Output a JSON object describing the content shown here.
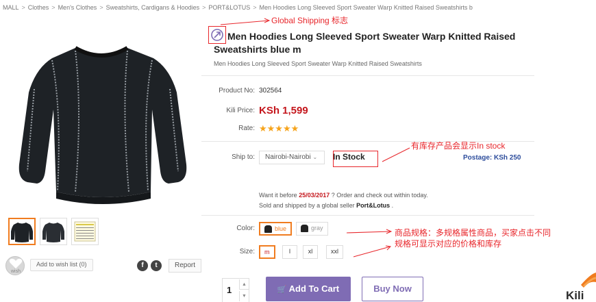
{
  "breadcrumb": [
    "MALL",
    "Clothes",
    "Men's Clothes",
    "Sweatshirts, Cardigans & Hoodies",
    "PORT&LOTUS",
    "Men Hoodies Long Sleeved Sport Sweater Warp Knitted Raised Sweatshirts b"
  ],
  "breadcrumb_sep": ">",
  "product": {
    "title": "Men Hoodies Long Sleeved Sport Sweater Warp Knitted Raised Sweatshirts blue m",
    "subtitle": "Men Hoodies Long Sleeved Sport Sweater Warp Knitted Raised Sweatshirts",
    "product_no_label": "Product No:",
    "product_no": "302564",
    "price_label": "Kili Price:",
    "price": "KSh 1,599",
    "rate_label": "Rate:",
    "rating": 5,
    "stars": "★★★★★",
    "ship_label": "Ship to:",
    "ship_to": "Nairobi-Nairobi",
    "stock": "In Stock",
    "postage": "Postage: KSh 250",
    "want_prefix": "Want it before ",
    "want_date": "25/03/2017",
    "want_suffix": " ? Order and check out within today.",
    "sold_prefix": "Sold and shipped by a global seller ",
    "seller": "Port&Lotus",
    "sold_suffix": " .",
    "color_label": "Color:",
    "colors": [
      {
        "label": "blue",
        "selected": true
      },
      {
        "label": "gray",
        "selected": false
      }
    ],
    "size_label": "Size:",
    "sizes": [
      {
        "label": "m",
        "selected": true
      },
      {
        "label": "l",
        "selected": false
      },
      {
        "label": "xl",
        "selected": false
      },
      {
        "label": "xxl",
        "selected": false
      }
    ],
    "quantity": "1",
    "add_to_cart": "Add To Cart",
    "buy_now": "Buy Now"
  },
  "wish": {
    "icon_text": "wish",
    "label": "Add to wish list (0)"
  },
  "report": "Report",
  "annotations": {
    "global_shipping": "Global Shipping 标志",
    "in_stock_note": "有库存产品会显示In stock",
    "spec_note_line1": "商品规格：多规格属性商品，买家点击不同",
    "spec_note_line2": "规格可显示对应的价格和库存"
  },
  "logo_text": "Kili",
  "colors": {
    "accent": "#7f6cb4",
    "price": "#c4161c",
    "selected": "#f07c1f",
    "annotation": "#e8262b",
    "postage": "#2d4d9c"
  }
}
